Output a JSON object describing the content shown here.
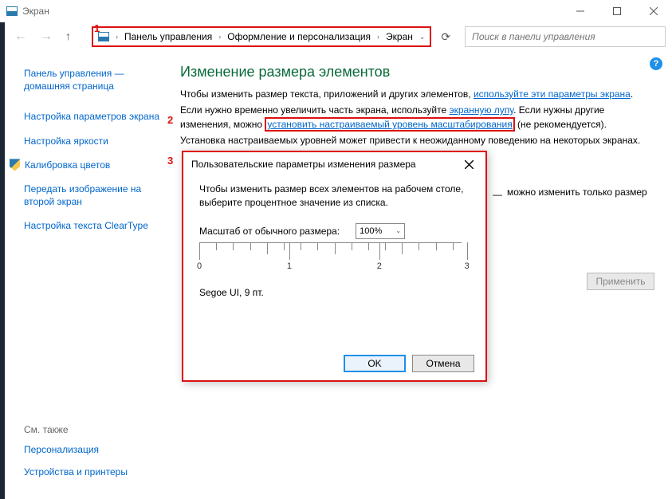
{
  "window": {
    "title": "Экран"
  },
  "breadcrumb": {
    "items": [
      "Панель управления",
      "Оформление и персонализация",
      "Экран"
    ]
  },
  "search": {
    "placeholder": "Поиск в панели управления"
  },
  "markers": {
    "m1": "1",
    "m2": "2",
    "m3": "3"
  },
  "sidebar": {
    "home": "Панель управления — домашняя страница",
    "items": [
      "Настройка параметров экрана",
      "Настройка яркости",
      "Калибровка цветов",
      "Передать изображение на второй экран",
      "Настройка текста ClearType"
    ],
    "footer_head": "См. также",
    "footer_items": [
      "Персонализация",
      "Устройства и принтеры"
    ]
  },
  "main": {
    "heading": "Изменение размера элементов",
    "p1a": "Чтобы изменить размер текста, приложений и других элементов, ",
    "p1_link": "используйте эти параметры экрана",
    "p1b": ".",
    "p2a": "Если нужно временно увеличить часть экрана, используйте ",
    "p2_link": "экранную лупу",
    "p2b": ". Если нужны другие изменения, можно ",
    "p2_link2": "установить настраиваемый уровень масштабирования",
    "p2c": " (не рекомендуется).",
    "p3": "Установка настраиваемых уровней может привести к неожиданному поведению на некоторых экранах.",
    "behind": "можно изменить только размер",
    "apply": "Применить"
  },
  "dialog": {
    "title": "Пользовательские параметры изменения размера",
    "desc": "Чтобы изменить размер всех элементов на рабочем столе, выберите процентное значение из списка.",
    "scale_label": "Масштаб от обычного размера:",
    "scale_value": "100%",
    "ruler_labels": [
      "0",
      "1",
      "2",
      "3"
    ],
    "sample": "Segoe UI, 9 пт.",
    "ok": "OK",
    "cancel": "Отмена"
  }
}
